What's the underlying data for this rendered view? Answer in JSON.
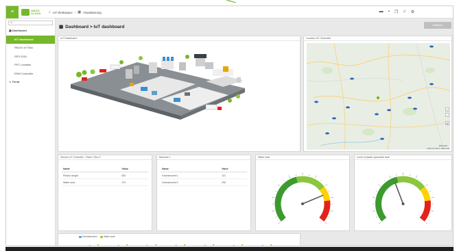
{
  "topbar": {
    "menu_icon": "hamburger-icon",
    "logo_line1": "WAGO",
    "logo_line2": "CLOUD",
    "breadcrumb": [
      "IoT Workspace",
      "Visualisierung"
    ],
    "icons": [
      "chat-icon",
      "bookmark-icon",
      "copy-icon",
      "bell-icon",
      "settings-icon"
    ]
  },
  "sidebar": {
    "search_value": "Io",
    "items": [
      {
        "label": "Dashboard",
        "level": 0,
        "active": false
      },
      {
        "label": "IoT dashboard",
        "level": 1,
        "active": true
      },
      {
        "label": "PAC01 IoT Box",
        "level": 1,
        "active": false
      },
      {
        "label": "SPS 2010",
        "level": 1,
        "active": false
      },
      {
        "label": "PFC Location",
        "level": 1,
        "active": false
      },
      {
        "label": "EDM Controller",
        "level": 1,
        "active": false
      },
      {
        "label": "Trend",
        "level": 0,
        "active": false
      }
    ]
  },
  "page": {
    "title": "Dashboard > IoT dashboard",
    "edit_button": "Editieren"
  },
  "panels": {
    "iot": {
      "title": "IoT Dashboard"
    },
    "map": {
      "title": "Location IoT Controller",
      "attribution": "2024 TomTom, Microsoft",
      "provider": "Microsoft"
    },
    "sensors": {
      "title": "Sensor IoT Controller - Rack 1 Box 3",
      "headers": [
        "Name",
        "Value"
      ],
      "rows": [
        [
          "Plastic weight",
          "830"
        ],
        [
          "Water tank",
          "370"
        ]
      ]
    },
    "machine": {
      "title": "Machine 1",
      "headers": [
        "Name",
        "Value"
      ],
      "rows": [
        [
          "Hochsteuerbr1",
          "121"
        ],
        [
          "Hochsteuerbr2",
          "250"
        ]
      ]
    },
    "water": {
      "title": "Water tank",
      "value_fraction": 0.76
    },
    "granule": {
      "title": "Level of plastic granulate tank",
      "value_fraction": 0.42
    },
    "trend": {
      "legend": [
        "Hochsteuerbr1",
        "Water tank"
      ],
      "colors": [
        "#5aa9e6",
        "#9ccc3c"
      ]
    }
  },
  "colors": {
    "accent": "#76b82a",
    "gauge_red": "#e3231b",
    "gauge_yellow": "#ffd200",
    "gauge_green": "#3c9a2e"
  }
}
